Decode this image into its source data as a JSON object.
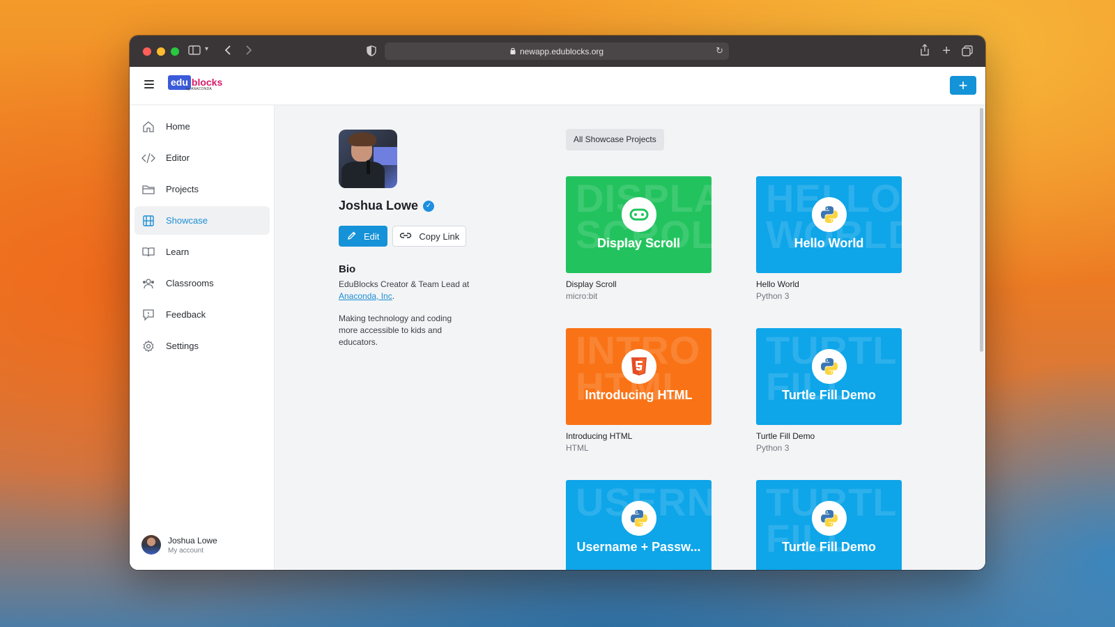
{
  "browser": {
    "url": "newapp.edublocks.org"
  },
  "app": {
    "logo_main": "edu",
    "logo_accent": "blocks",
    "logo_sub": "by ANACONDA",
    "add_button": "+"
  },
  "sidebar": {
    "items": [
      {
        "label": "Home",
        "icon": "home-icon",
        "active": false
      },
      {
        "label": "Editor",
        "icon": "code-icon",
        "active": false
      },
      {
        "label": "Projects",
        "icon": "folder-icon",
        "active": false
      },
      {
        "label": "Showcase",
        "icon": "film-icon",
        "active": true
      },
      {
        "label": "Learn",
        "icon": "book-icon",
        "active": false
      },
      {
        "label": "Classrooms",
        "icon": "users-icon",
        "active": false
      },
      {
        "label": "Feedback",
        "icon": "feedback-icon",
        "active": false
      },
      {
        "label": "Settings",
        "icon": "gear-icon",
        "active": false
      }
    ],
    "account": {
      "name": "Joshua Lowe",
      "sub": "My account"
    }
  },
  "profile": {
    "name": "Joshua Lowe",
    "edit_label": "Edit",
    "copy_label": "Copy Link",
    "bio_title": "Bio",
    "bio_line1": "EduBlocks Creator & Team Lead at",
    "bio_link": "Anaconda, Inc",
    "bio_line1_end": ".",
    "bio_line2": "Making technology and coding more accessible to kids and educators."
  },
  "showcase": {
    "filter_label": "All Showcase Projects",
    "colors": {
      "green": "#22c35e",
      "blue": "#0ea5e9",
      "orange": "#f97316"
    },
    "cards": [
      {
        "thumb_title": "Display Scroll",
        "bg_text": "DISPLA\nSCROLL",
        "title": "Display Scroll",
        "sub": "micro:bit",
        "color": "#22c35e",
        "icon": "microbit-icon"
      },
      {
        "thumb_title": "Hello World",
        "bg_text": "HELLO\nWORLD",
        "title": "Hello World",
        "sub": "Python 3",
        "color": "#0ea5e9",
        "icon": "python-icon"
      },
      {
        "thumb_title": "Introducing HTML",
        "bg_text": "INTRO\nHTML",
        "title": "Introducing HTML",
        "sub": "HTML",
        "color": "#f97316",
        "icon": "html5-icon"
      },
      {
        "thumb_title": "Turtle Fill Demo",
        "bg_text": "TURTL\nFILL",
        "title": "Turtle Fill Demo",
        "sub": "Python 3",
        "color": "#0ea5e9",
        "icon": "python-icon"
      },
      {
        "thumb_title": "Username + Passw...",
        "bg_text": "USERN",
        "title": "",
        "sub": "",
        "color": "#0ea5e9",
        "icon": "python-icon"
      },
      {
        "thumb_title": "Turtle Fill Demo",
        "bg_text": "TURTL\nFILL",
        "title": "",
        "sub": "",
        "color": "#0ea5e9",
        "icon": "python-icon"
      }
    ]
  }
}
